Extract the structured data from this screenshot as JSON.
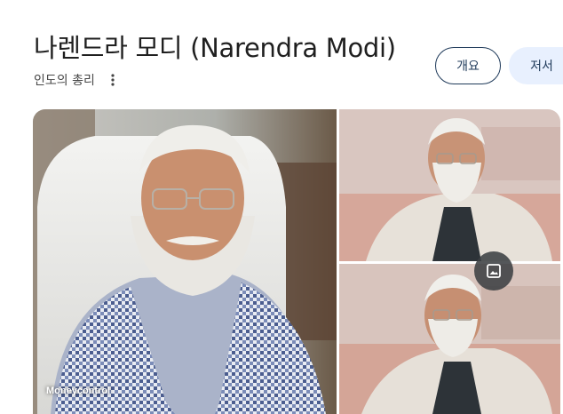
{
  "header": {
    "title": "나렌드라 모디 (Narendra Modi)",
    "subtitle": "인도의 총리"
  },
  "chips": {
    "overview": "개요",
    "works": "저서"
  },
  "gallery": {
    "source": "Moneycontrol"
  },
  "icons": {
    "more": "more-vert-icon",
    "image": "image-icon"
  },
  "colors": {
    "chip_border": "#1f3a5a",
    "chip_fill": "#e8f0fe",
    "fab": "#3c4043"
  }
}
